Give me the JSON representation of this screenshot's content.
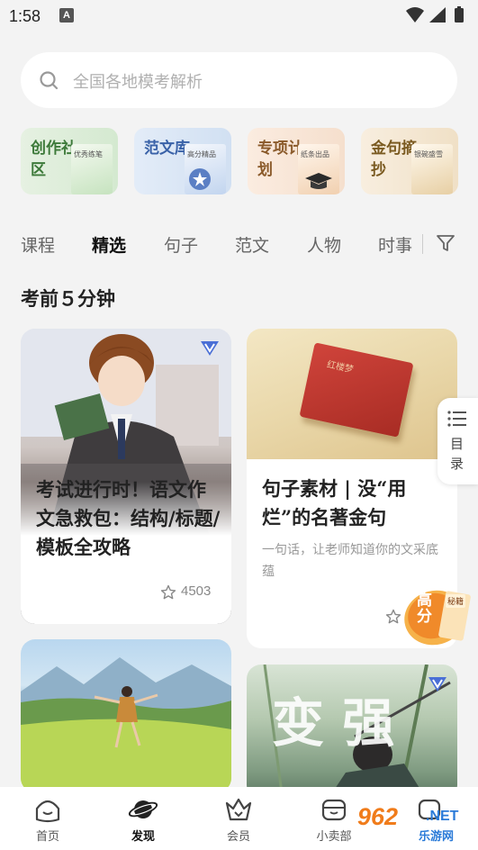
{
  "status_bar": {
    "time": "1:58",
    "notification_letter": "A"
  },
  "search": {
    "placeholder": "全国各地模考解析"
  },
  "quick_cards": [
    {
      "title": "创作社区",
      "book_label": "优秀练笔"
    },
    {
      "title": "范文库",
      "book_label": "高分精品"
    },
    {
      "title": "专项计划",
      "book_label": "纸条出品"
    },
    {
      "title": "金句摘抄",
      "book_label": "银碗盛雪"
    }
  ],
  "tabs": [
    "课程",
    "精选",
    "句子",
    "范文",
    "人物",
    "时事"
  ],
  "active_tab": "精选",
  "section_title": "考前５分钟",
  "cards": [
    {
      "title": "考试进行时！语文作文急救包：结构/标题/模板全攻略",
      "favorites": "4503"
    },
    {
      "title": "句子素材 | 没“用烂”的名著金句",
      "description": "一句话，让老师知道你的文采底蕴",
      "book_label": "红楼梦"
    },
    {
      "title": ""
    },
    {
      "image_text": "变 强"
    }
  ],
  "promo_badge": {
    "title": "高分",
    "subtitle": "秘籍"
  },
  "toc": {
    "label": "目录"
  },
  "bottom_nav": [
    {
      "label": "首页",
      "icon": "home-icon"
    },
    {
      "label": "发现",
      "icon": "planet-icon"
    },
    {
      "label": "会员",
      "icon": "crown-icon"
    },
    {
      "label": "小卖部",
      "icon": "store-icon"
    },
    {
      "label": "",
      "icon": "profile-icon"
    }
  ],
  "watermark": {
    "number": "962",
    "domain": ".NET",
    "name": "乐游网"
  },
  "colors": {
    "background": "#f3f3f3",
    "vip_badge": "#4a6fd6",
    "promo_orange": "#f08a2a"
  }
}
